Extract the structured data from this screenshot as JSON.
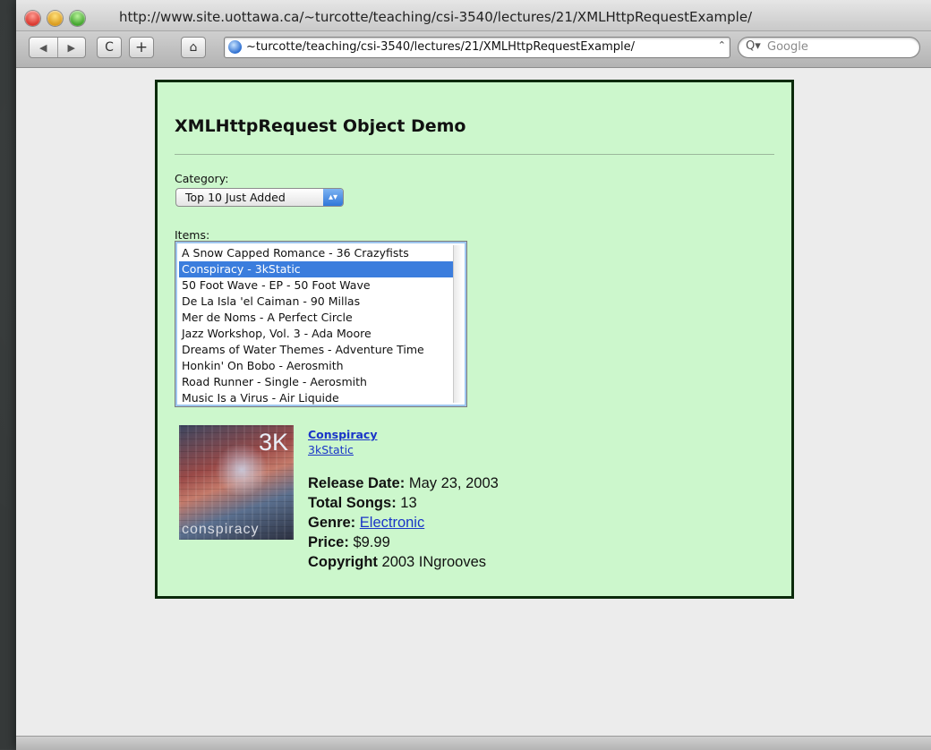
{
  "window": {
    "title": "http://www.site.uottawa.ca/~turcotte/teaching/csi-3540/lectures/21/XMLHttpRequestExample/"
  },
  "toolbar": {
    "back_icon": "◀",
    "forward_icon": "▶",
    "reload_icon": "C",
    "add_icon": "+",
    "home_icon": "⌂",
    "address": "~turcotte/teaching/csi-3540/lectures/21/XMLHttpRequestExample/",
    "search_placeholder": "Google"
  },
  "page": {
    "heading": "XMLHttpRequest Object Demo",
    "category_label": "Category:",
    "category_selected": "Top 10 Just Added",
    "items_label": "Items:",
    "items": [
      {
        "label": "A Snow Capped Romance - 36 Crazyfists",
        "selected": false
      },
      {
        "label": "Conspiracy - 3kStatic",
        "selected": true
      },
      {
        "label": "50 Foot Wave - EP - 50 Foot Wave",
        "selected": false
      },
      {
        "label": "De La Isla 'el Caiman - 90 Millas",
        "selected": false
      },
      {
        "label": "Mer de Noms - A Perfect Circle",
        "selected": false
      },
      {
        "label": "Jazz Workshop, Vol. 3 - Ada Moore",
        "selected": false
      },
      {
        "label": "Dreams of Water Themes - Adventure Time",
        "selected": false
      },
      {
        "label": "Honkin' On Bobo - Aerosmith",
        "selected": false
      },
      {
        "label": "Road Runner - Single - Aerosmith",
        "selected": false
      },
      {
        "label": "Music Is a Virus - Air Liquide",
        "selected": false
      }
    ],
    "details": {
      "cover_text_top": "3K",
      "cover_text_bottom": "conspiracy",
      "album": "Conspiracy",
      "artist": "3kStatic",
      "release_date_label": "Release Date:",
      "release_date": "May 23, 2003",
      "total_songs_label": "Total Songs:",
      "total_songs": "13",
      "genre_label": "Genre:",
      "genre": "Electronic",
      "price_label": "Price:",
      "price": "$9.99",
      "copyright_label": "Copyright",
      "copyright": "2003 INgrooves"
    }
  },
  "colors": {
    "panel_background": "#ccf7cc",
    "panel_border": "#0b2a0b",
    "link": "#1a35c8",
    "selection": "#3b7ddd"
  }
}
